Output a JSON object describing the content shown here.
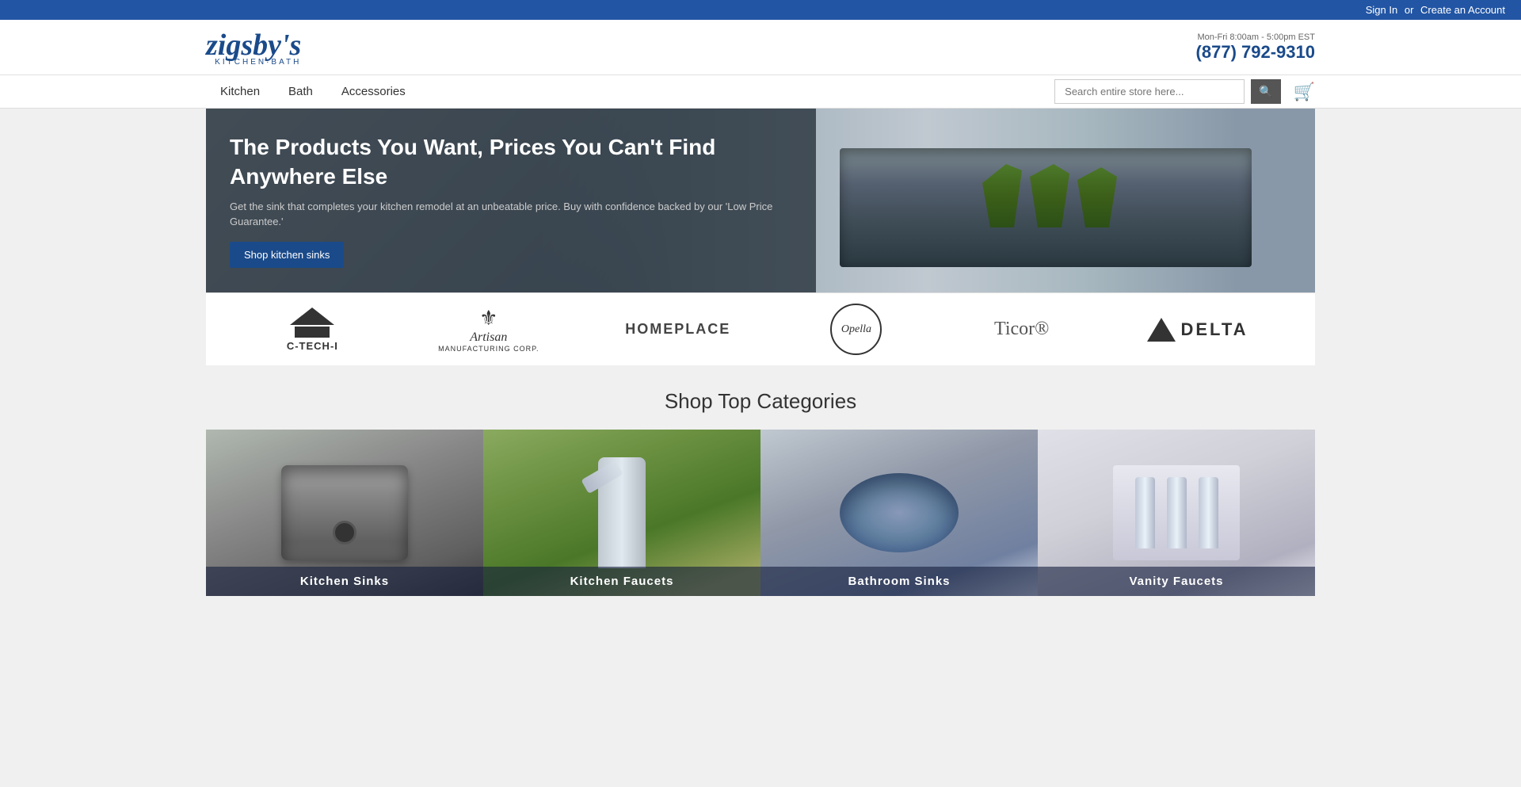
{
  "topbar": {
    "signin_label": "Sign In",
    "or_text": "or",
    "create_account_label": "Create an Account"
  },
  "header": {
    "logo_main": "zigsby's",
    "logo_sub": "KITCHEN·BATH",
    "hours_label": "Mon-Fri 8:00am - 5:00pm EST",
    "phone": "(877) 792-9310"
  },
  "nav": {
    "items": [
      {
        "label": "Kitchen",
        "id": "kitchen"
      },
      {
        "label": "Bath",
        "id": "bath"
      },
      {
        "label": "Accessories",
        "id": "accessories"
      }
    ],
    "search_placeholder": "Search entire store here...",
    "cart_icon": "🛒"
  },
  "hero": {
    "title": "The Products You Want, Prices You Can't Find Anywhere Else",
    "description": "Get the sink that completes your kitchen remodel at an unbeatable price. Buy with confidence backed by our 'Low Price Guarantee.'",
    "cta_label": "Shop kitchen sinks"
  },
  "brands": [
    {
      "name": "C-TECH-I",
      "type": "ctechi"
    },
    {
      "name": "Artisan Manufacturing Corp.",
      "type": "artisan"
    },
    {
      "name": "HOMEPLACE",
      "type": "homeplace"
    },
    {
      "name": "Opella",
      "type": "opella"
    },
    {
      "name": "Ticor",
      "type": "ticor"
    },
    {
      "name": "DELTA",
      "type": "delta"
    }
  ],
  "categories": {
    "section_title": "Shop Top Categories",
    "items": [
      {
        "label": "Kitchen Sinks",
        "type": "sink"
      },
      {
        "label": "Kitchen Faucets",
        "type": "faucet"
      },
      {
        "label": "Bathroom Sinks",
        "type": "bath-sink"
      },
      {
        "label": "Vanity Faucets",
        "type": "vanity"
      }
    ]
  }
}
